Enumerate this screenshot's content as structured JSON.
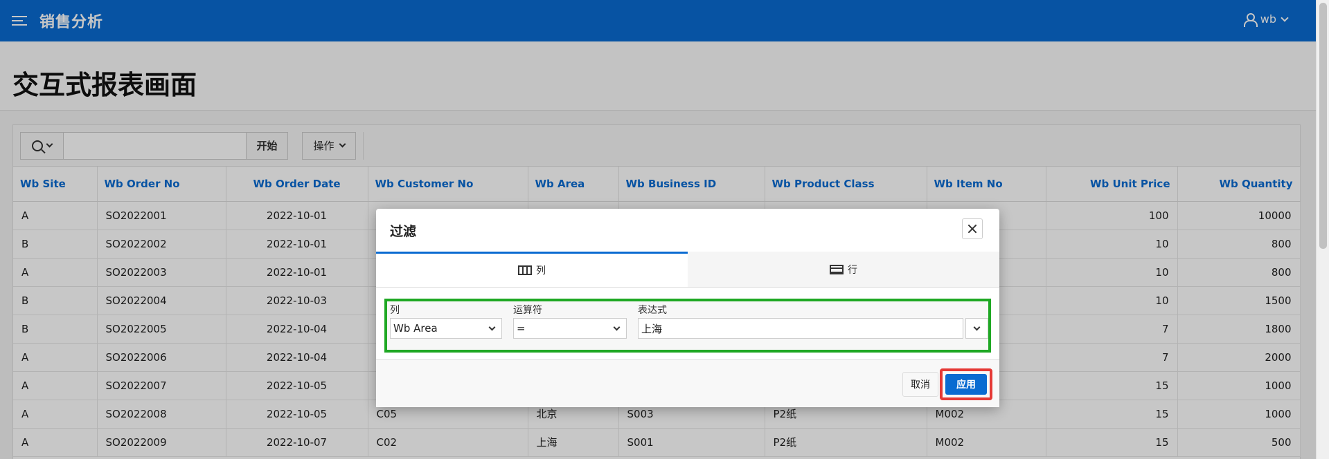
{
  "header": {
    "app_title": "销售分析",
    "user": "wb"
  },
  "page": {
    "title": "交互式报表画面"
  },
  "toolbar": {
    "search_value": "",
    "go_label": "开始",
    "actions_label": "操作"
  },
  "table": {
    "columns": [
      "Wb Site",
      "Wb Order No",
      "Wb Order Date",
      "Wb Customer No",
      "Wb Area",
      "Wb Business ID",
      "Wb Product Class",
      "Wb Item No",
      "Wb Unit Price",
      "Wb Quantity"
    ],
    "rows": [
      [
        "A",
        "SO2022001",
        "2022-10-01",
        "",
        "",
        "",
        "",
        "",
        "100",
        "10000"
      ],
      [
        "B",
        "SO2022002",
        "2022-10-01",
        "",
        "",
        "",
        "",
        "",
        "10",
        "800"
      ],
      [
        "A",
        "SO2022003",
        "2022-10-01",
        "",
        "",
        "",
        "",
        "",
        "10",
        "800"
      ],
      [
        "B",
        "SO2022004",
        "2022-10-03",
        "",
        "",
        "",
        "",
        "",
        "10",
        "1500"
      ],
      [
        "B",
        "SO2022005",
        "2022-10-04",
        "",
        "",
        "",
        "",
        "",
        "7",
        "1800"
      ],
      [
        "A",
        "SO2022006",
        "2022-10-04",
        "",
        "",
        "",
        "",
        "",
        "7",
        "2000"
      ],
      [
        "A",
        "SO2022007",
        "2022-10-05",
        "",
        "",
        "",
        "",
        "",
        "15",
        "1000"
      ],
      [
        "A",
        "SO2022008",
        "2022-10-05",
        "C05",
        "北京",
        "S003",
        "P2纸",
        "M002",
        "15",
        "1000"
      ],
      [
        "A",
        "SO2022009",
        "2022-10-07",
        "C02",
        "上海",
        "S001",
        "P2纸",
        "M002",
        "15",
        "500"
      ]
    ]
  },
  "dialog": {
    "title": "过滤",
    "tabs": [
      "列",
      "行"
    ],
    "filter": {
      "column_label": "列",
      "column_value": "Wb Area",
      "operator_label": "运算符",
      "operator_value": "=",
      "expression_label": "表达式",
      "expression_value": "上海"
    },
    "cancel_label": "取消",
    "apply_label": "应用"
  }
}
